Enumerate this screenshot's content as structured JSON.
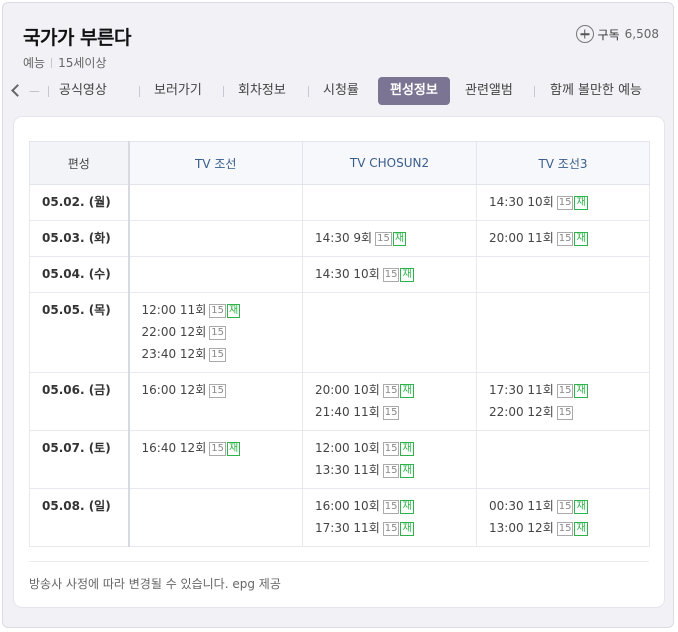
{
  "program": {
    "title": "국가가 부른다",
    "genre": "예능",
    "rating": "15세이상"
  },
  "subscribe": {
    "label": "구독",
    "count": "6,508"
  },
  "tabs": {
    "partial": "ㅡ",
    "items": [
      "공식영상",
      "보러가기",
      "회차정보",
      "시청률",
      "편성정보",
      "관련앨범",
      "함께 볼만한 예능"
    ],
    "active": "편성정보"
  },
  "schedule": {
    "headers": [
      "편성",
      "TV 조선",
      "TV CHOSUN2",
      "TV 조선3"
    ],
    "rows": [
      {
        "date": "05.02. (월)",
        "ch1": [],
        "ch2": [],
        "ch3": [
          {
            "time": "14:30",
            "ep": "10회",
            "age": "15",
            "re": "재"
          }
        ]
      },
      {
        "date": "05.03. (화)",
        "ch1": [],
        "ch2": [
          {
            "time": "14:30",
            "ep": "9회",
            "age": "15",
            "re": "재"
          }
        ],
        "ch3": [
          {
            "time": "20:00",
            "ep": "11회",
            "age": "15",
            "re": "재"
          }
        ]
      },
      {
        "date": "05.04. (수)",
        "ch1": [],
        "ch2": [
          {
            "time": "14:30",
            "ep": "10회",
            "age": "15",
            "re": "재"
          }
        ],
        "ch3": []
      },
      {
        "date": "05.05. (목)",
        "ch1": [
          {
            "time": "12:00",
            "ep": "11회",
            "age": "15",
            "re": "재"
          },
          {
            "time": "22:00",
            "ep": "12회",
            "age": "15",
            "re": ""
          },
          {
            "time": "23:40",
            "ep": "12회",
            "age": "15",
            "re": ""
          }
        ],
        "ch2": [],
        "ch3": []
      },
      {
        "date": "05.06. (금)",
        "ch1": [
          {
            "time": "16:00",
            "ep": "12회",
            "age": "15",
            "re": ""
          }
        ],
        "ch2": [
          {
            "time": "20:00",
            "ep": "10회",
            "age": "15",
            "re": "재"
          },
          {
            "time": "21:40",
            "ep": "11회",
            "age": "15",
            "re": ""
          }
        ],
        "ch3": [
          {
            "time": "17:30",
            "ep": "11회",
            "age": "15",
            "re": "재"
          },
          {
            "time": "22:00",
            "ep": "12회",
            "age": "15",
            "re": ""
          }
        ]
      },
      {
        "date": "05.07. (토)",
        "ch1": [
          {
            "time": "16:40",
            "ep": "12회",
            "age": "15",
            "re": "재"
          }
        ],
        "ch2": [
          {
            "time": "12:00",
            "ep": "10회",
            "age": "15",
            "re": "재"
          },
          {
            "time": "13:30",
            "ep": "11회",
            "age": "15",
            "re": "재"
          }
        ],
        "ch3": []
      },
      {
        "date": "05.08. (일)",
        "ch1": [],
        "ch2": [
          {
            "time": "16:00",
            "ep": "10회",
            "age": "15",
            "re": "재"
          },
          {
            "time": "17:30",
            "ep": "11회",
            "age": "15",
            "re": "재"
          }
        ],
        "ch3": [
          {
            "time": "00:30",
            "ep": "11회",
            "age": "15",
            "re": "재"
          },
          {
            "time": "13:00",
            "ep": "12회",
            "age": "15",
            "re": "재"
          }
        ]
      }
    ]
  },
  "notice": "방송사 사정에 따라 변경될 수 있습니다. epg 제공",
  "colors": {
    "active_tab": "#7b7492",
    "rerun_badge": "#2db34a",
    "header_text": "#3a5d8c"
  },
  "icons": {
    "subscribe": "plus-circle-icon",
    "tabs_prev": "chevron-left-icon"
  }
}
